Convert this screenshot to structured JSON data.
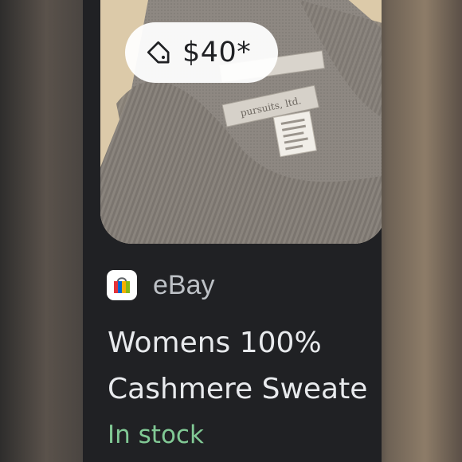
{
  "product": {
    "price": "$40*",
    "source_name": "eBay",
    "title_lines": [
      "Womens 100%",
      "Cashmere Sweate"
    ],
    "stock_status": "In stock",
    "photo_label_text": "pursuits, ltd."
  },
  "icons": {
    "price_tag": "tag-icon",
    "source_logo": "shopping-bag-icon"
  },
  "colors": {
    "card_background": "#202124",
    "price_pill": "#ffffff",
    "stock_green": "#81c995",
    "title_text": "#e8eaed",
    "source_text": "#bdc1c6"
  }
}
